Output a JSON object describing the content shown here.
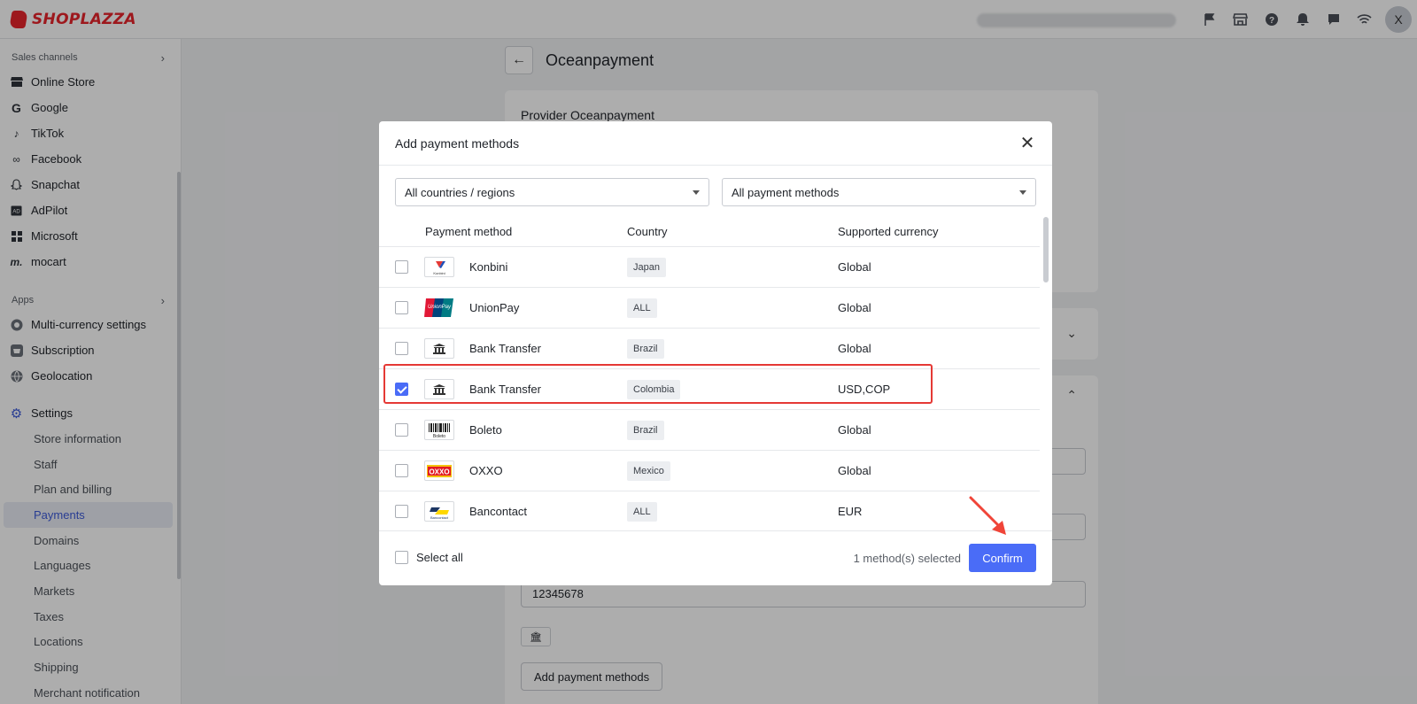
{
  "brand": {
    "name": "SHOPLAZZA",
    "color": "#e8242b"
  },
  "topbar": {
    "icons": [
      "flag-icon",
      "store-icon",
      "help-icon",
      "bell-icon",
      "chat-icon",
      "wifi-icon"
    ],
    "avatar_initial": "X"
  },
  "sidebar": {
    "sales_channels": {
      "title": "Sales channels",
      "items": [
        {
          "label": "Online Store",
          "icon": "store-icon"
        },
        {
          "label": "Google",
          "icon": "google-icon"
        },
        {
          "label": "TikTok",
          "icon": "tiktok-icon"
        },
        {
          "label": "Facebook",
          "icon": "meta-icon"
        },
        {
          "label": "Snapchat",
          "icon": "ghost-icon"
        },
        {
          "label": "AdPilot",
          "icon": "ad-icon"
        },
        {
          "label": "Microsoft",
          "icon": "grid-icon"
        },
        {
          "label": "mocart",
          "icon": "mocart-icon"
        }
      ]
    },
    "apps": {
      "title": "Apps",
      "items": [
        {
          "label": "Multi-currency settings",
          "icon": "currency-icon"
        },
        {
          "label": "Subscription",
          "icon": "subscription-icon"
        },
        {
          "label": "Geolocation",
          "icon": "globe-icon"
        }
      ]
    },
    "settings": {
      "label": "Settings",
      "items": [
        "Store information",
        "Staff",
        "Plan and billing",
        "Payments",
        "Domains",
        "Languages",
        "Markets",
        "Taxes",
        "Locations",
        "Shipping",
        "Merchant notification"
      ],
      "active": "Payments"
    }
  },
  "page": {
    "title": "Oceanpayment",
    "provider_label": "Provider Oceanpayment",
    "account_value": "12345678",
    "add_methods_label": "Add payment methods"
  },
  "modal": {
    "title": "Add payment methods",
    "filter_country": "All countries / regions",
    "filter_method": "All payment methods",
    "columns": {
      "method": "Payment method",
      "country": "Country",
      "currency": "Supported currency"
    },
    "rows": [
      {
        "name": "Konbini",
        "country": "Japan",
        "currency": "Global",
        "checked": false,
        "logo": "konbini-logo"
      },
      {
        "name": "UnionPay",
        "country": "ALL",
        "currency": "Global",
        "checked": false,
        "logo": "unionpay-logo"
      },
      {
        "name": "Bank Transfer",
        "country": "Brazil",
        "currency": "Global",
        "checked": false,
        "logo": "bank-icon"
      },
      {
        "name": "Bank Transfer",
        "country": "Colombia",
        "currency": "USD,COP",
        "checked": true,
        "logo": "bank-icon"
      },
      {
        "name": "Boleto",
        "country": "Brazil",
        "currency": "Global",
        "checked": false,
        "logo": "boleto-logo"
      },
      {
        "name": "OXXO",
        "country": "Mexico",
        "currency": "Global",
        "checked": false,
        "logo": "oxxo-logo"
      },
      {
        "name": "Bancontact",
        "country": "ALL",
        "currency": "EUR",
        "checked": false,
        "logo": "bancontact-logo"
      }
    ],
    "select_all_label": "Select all",
    "selected_count": "1 method(s) selected",
    "confirm_label": "Confirm",
    "accent_color": "#4a6cf7"
  }
}
